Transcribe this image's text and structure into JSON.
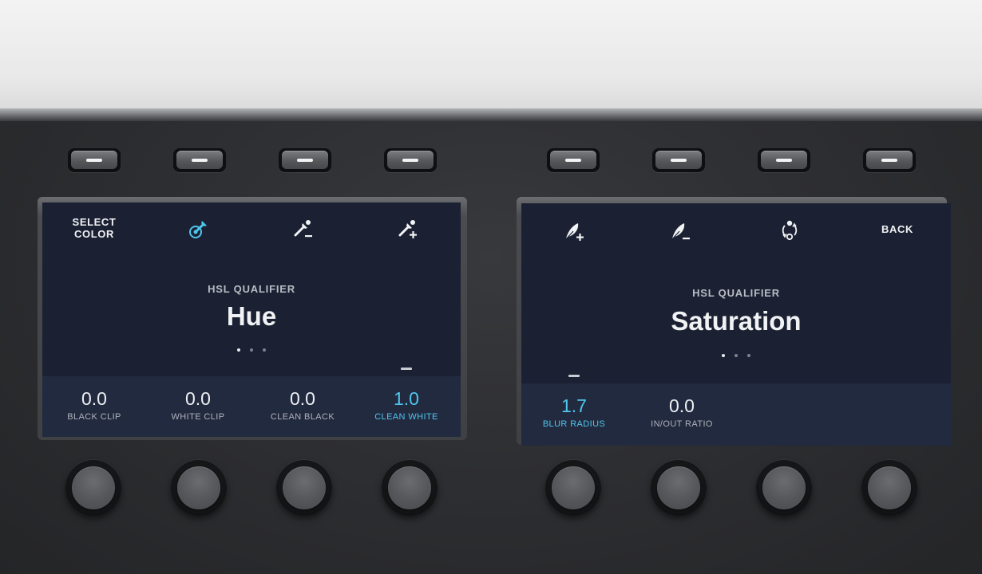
{
  "left_screen": {
    "top_buttons": [
      {
        "type": "text",
        "label": "SELECT\nCOLOR"
      },
      {
        "type": "icon",
        "icon": "picker-target-icon",
        "color": "#4fc6ec"
      },
      {
        "type": "icon",
        "icon": "picker-minus-icon"
      },
      {
        "type": "icon",
        "icon": "picker-plus-icon"
      }
    ],
    "subtitle": "HSL QUALIFIER",
    "title": "Hue",
    "page_dots": {
      "count": 3,
      "active": 1
    },
    "params": [
      {
        "value": "0.0",
        "label": "BLACK CLIP",
        "active": false
      },
      {
        "value": "0.0",
        "label": "WHITE CLIP",
        "active": false
      },
      {
        "value": "0.0",
        "label": "CLEAN BLACK",
        "active": false
      },
      {
        "value": "1.0",
        "label": "CLEAN WHITE",
        "active": true
      }
    ]
  },
  "right_screen": {
    "top_buttons": [
      {
        "type": "icon",
        "icon": "feather-plus-icon"
      },
      {
        "type": "icon",
        "icon": "feather-minus-icon"
      },
      {
        "type": "icon",
        "icon": "nodes-cycle-icon"
      },
      {
        "type": "text",
        "label": "BACK"
      }
    ],
    "subtitle": "HSL QUALIFIER",
    "title": "Saturation",
    "page_dots": {
      "count": 3,
      "active": 1
    },
    "params": [
      {
        "value": "1.7",
        "label": "BLUR RADIUS",
        "active": true
      },
      {
        "value": "0.0",
        "label": "IN/OUT RATIO",
        "active": false
      }
    ]
  },
  "colors": {
    "screen_bg": "#1b2133",
    "band_bg": "#222a3f",
    "accent": "#4fc6ec"
  }
}
